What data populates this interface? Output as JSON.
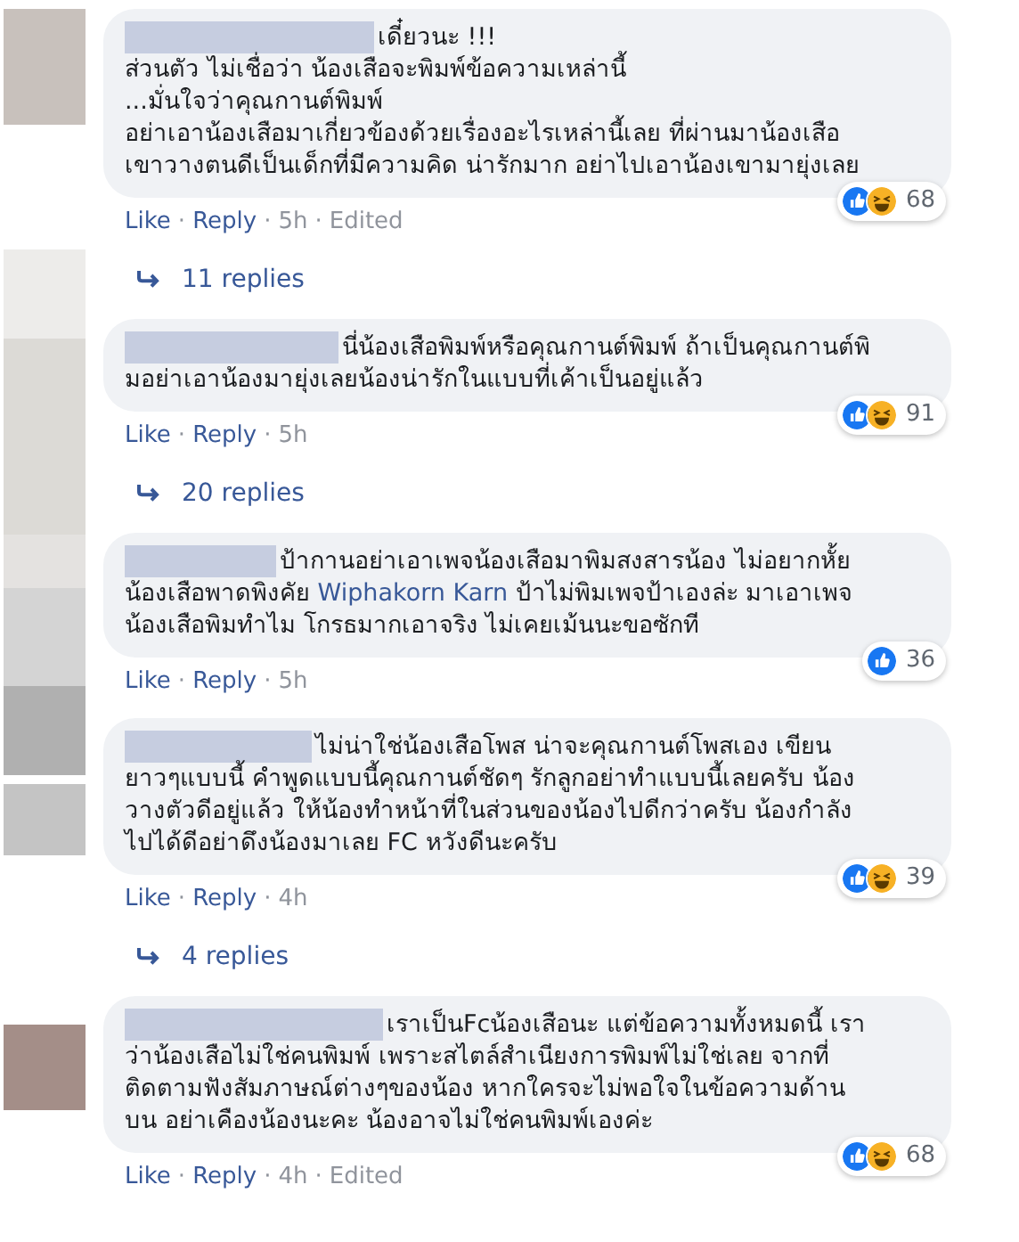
{
  "separator": "·",
  "comments": [
    {
      "lines": [
        [
          {
            "kind": "text",
            "text": "เดี๋ยวนะ !!!"
          }
        ],
        [
          {
            "kind": "text",
            "text": "ส่วนตัว ไม่เชื่อว่า น้องเสือจะพิมพ์ข้อความเหล่านี้"
          }
        ],
        [
          {
            "kind": "text",
            "text": "...มั่นใจว่าคุณกานต์พิมพ์"
          }
        ],
        [
          {
            "kind": "text",
            "text": "อย่าเอาน้องเสือมาเกี่ยวข้องด้วยเรื่องอะไรเหล่านี้เลย ที่ผ่านมาน้องเสือ"
          }
        ],
        [
          {
            "kind": "text",
            "text": "เขาวางตนดีเป็นเด็กที่มีความคิด น่ารักมาก อย่าไปเอาน้องเขามายุ่งเลย"
          }
        ]
      ],
      "reactions": [
        {
          "kind": "like"
        },
        {
          "kind": "haha"
        }
      ],
      "count": "68",
      "actions": [
        "Like",
        "Reply"
      ],
      "time": "5h",
      "edited": "Edited",
      "replies": "11 replies"
    },
    {
      "lines": [
        [
          {
            "kind": "text",
            "text": "นี่น้องเสือพิมพ์หรือคุณกานต์พิมพ์ ถ้าเป็นคุณกานต์พิ"
          }
        ],
        [
          {
            "kind": "text",
            "text": "มอย่าเอาน้องมายุ่งเลยน้องน่ารักในแบบที่เค้าเป็นอยู่แล้ว"
          }
        ]
      ],
      "reactions": [
        {
          "kind": "like"
        },
        {
          "kind": "haha"
        }
      ],
      "count": "91",
      "actions": [
        "Like",
        "Reply"
      ],
      "time": "5h",
      "replies": "20 replies"
    },
    {
      "lines": [
        [
          {
            "kind": "text",
            "text": "ป้ากานอย่าเอาเพจน้องเสือมาพิมสงสารน้อง ไม่อยากหั้ย"
          }
        ],
        [
          {
            "kind": "text",
            "text": "น้องเสือพาดพิงคัย "
          },
          {
            "kind": "mention",
            "text": "Wiphakorn Karn"
          },
          {
            "kind": "text",
            "text": " ป้าไม่พิมเพจป้าเองล่ะ มาเอาเพจ"
          }
        ],
        [
          {
            "kind": "text",
            "text": "น้องเสือพิมทำไม โกรธมากเอาจริง ไม่เคยเม้นนะขอซักที"
          }
        ]
      ],
      "reactions": [
        {
          "kind": "like"
        }
      ],
      "count": "36",
      "actions": [
        "Like",
        "Reply"
      ],
      "time": "5h"
    },
    {
      "lines": [
        [
          {
            "kind": "text",
            "text": "ไม่น่าใช่น้องเสือโพส น่าจะคุณกานต์โพสเอง เขียน"
          }
        ],
        [
          {
            "kind": "text",
            "text": "ยาวๆแบบนี้ คำพูดแบบนี้คุณกานต์ชัดๆ รักลูกอย่าทำแบบนี้เลยครับ น้อง"
          }
        ],
        [
          {
            "kind": "text",
            "text": "วางตัวดีอยู่แล้ว ให้น้องทำหน้าที่ในส่วนของน้องไปดีกว่าครับ น้องกำลัง"
          }
        ],
        [
          {
            "kind": "text",
            "text": "ไปได้ดีอย่าดึงน้องมาเลย FC หวังดีนะครับ"
          }
        ]
      ],
      "reactions": [
        {
          "kind": "like"
        },
        {
          "kind": "haha"
        }
      ],
      "count": "39",
      "actions": [
        "Like",
        "Reply"
      ],
      "time": "4h",
      "replies": "4 replies"
    },
    {
      "lines": [
        [
          {
            "kind": "text",
            "text": "เราเป็นFcน้องเสือนะ แต่ข้อความทั้งหมดนี้ เรา"
          }
        ],
        [
          {
            "kind": "text",
            "text": "ว่าน้องเสือไม่ใช่คนพิมพ์ เพราะสไตล์สำเนียงการพิมพ์ไม่ใช่เลย จากที่"
          }
        ],
        [
          {
            "kind": "text",
            "text": "ติดตามฟังสัมภาษณ์ต่างๆของน้อง หากใครจะไม่พอใจในข้อความด้าน"
          }
        ],
        [
          {
            "kind": "text",
            "text": "บน อย่าเคืองน้องนะคะ น้องอาจไม่ใช่คนพิมพ์เองค่ะ"
          }
        ]
      ],
      "reactions": [
        {
          "kind": "like"
        },
        {
          "kind": "haha"
        }
      ],
      "count": "68",
      "actions": [
        "Like",
        "Reply"
      ],
      "time": "4h",
      "edited": "Edited"
    }
  ]
}
